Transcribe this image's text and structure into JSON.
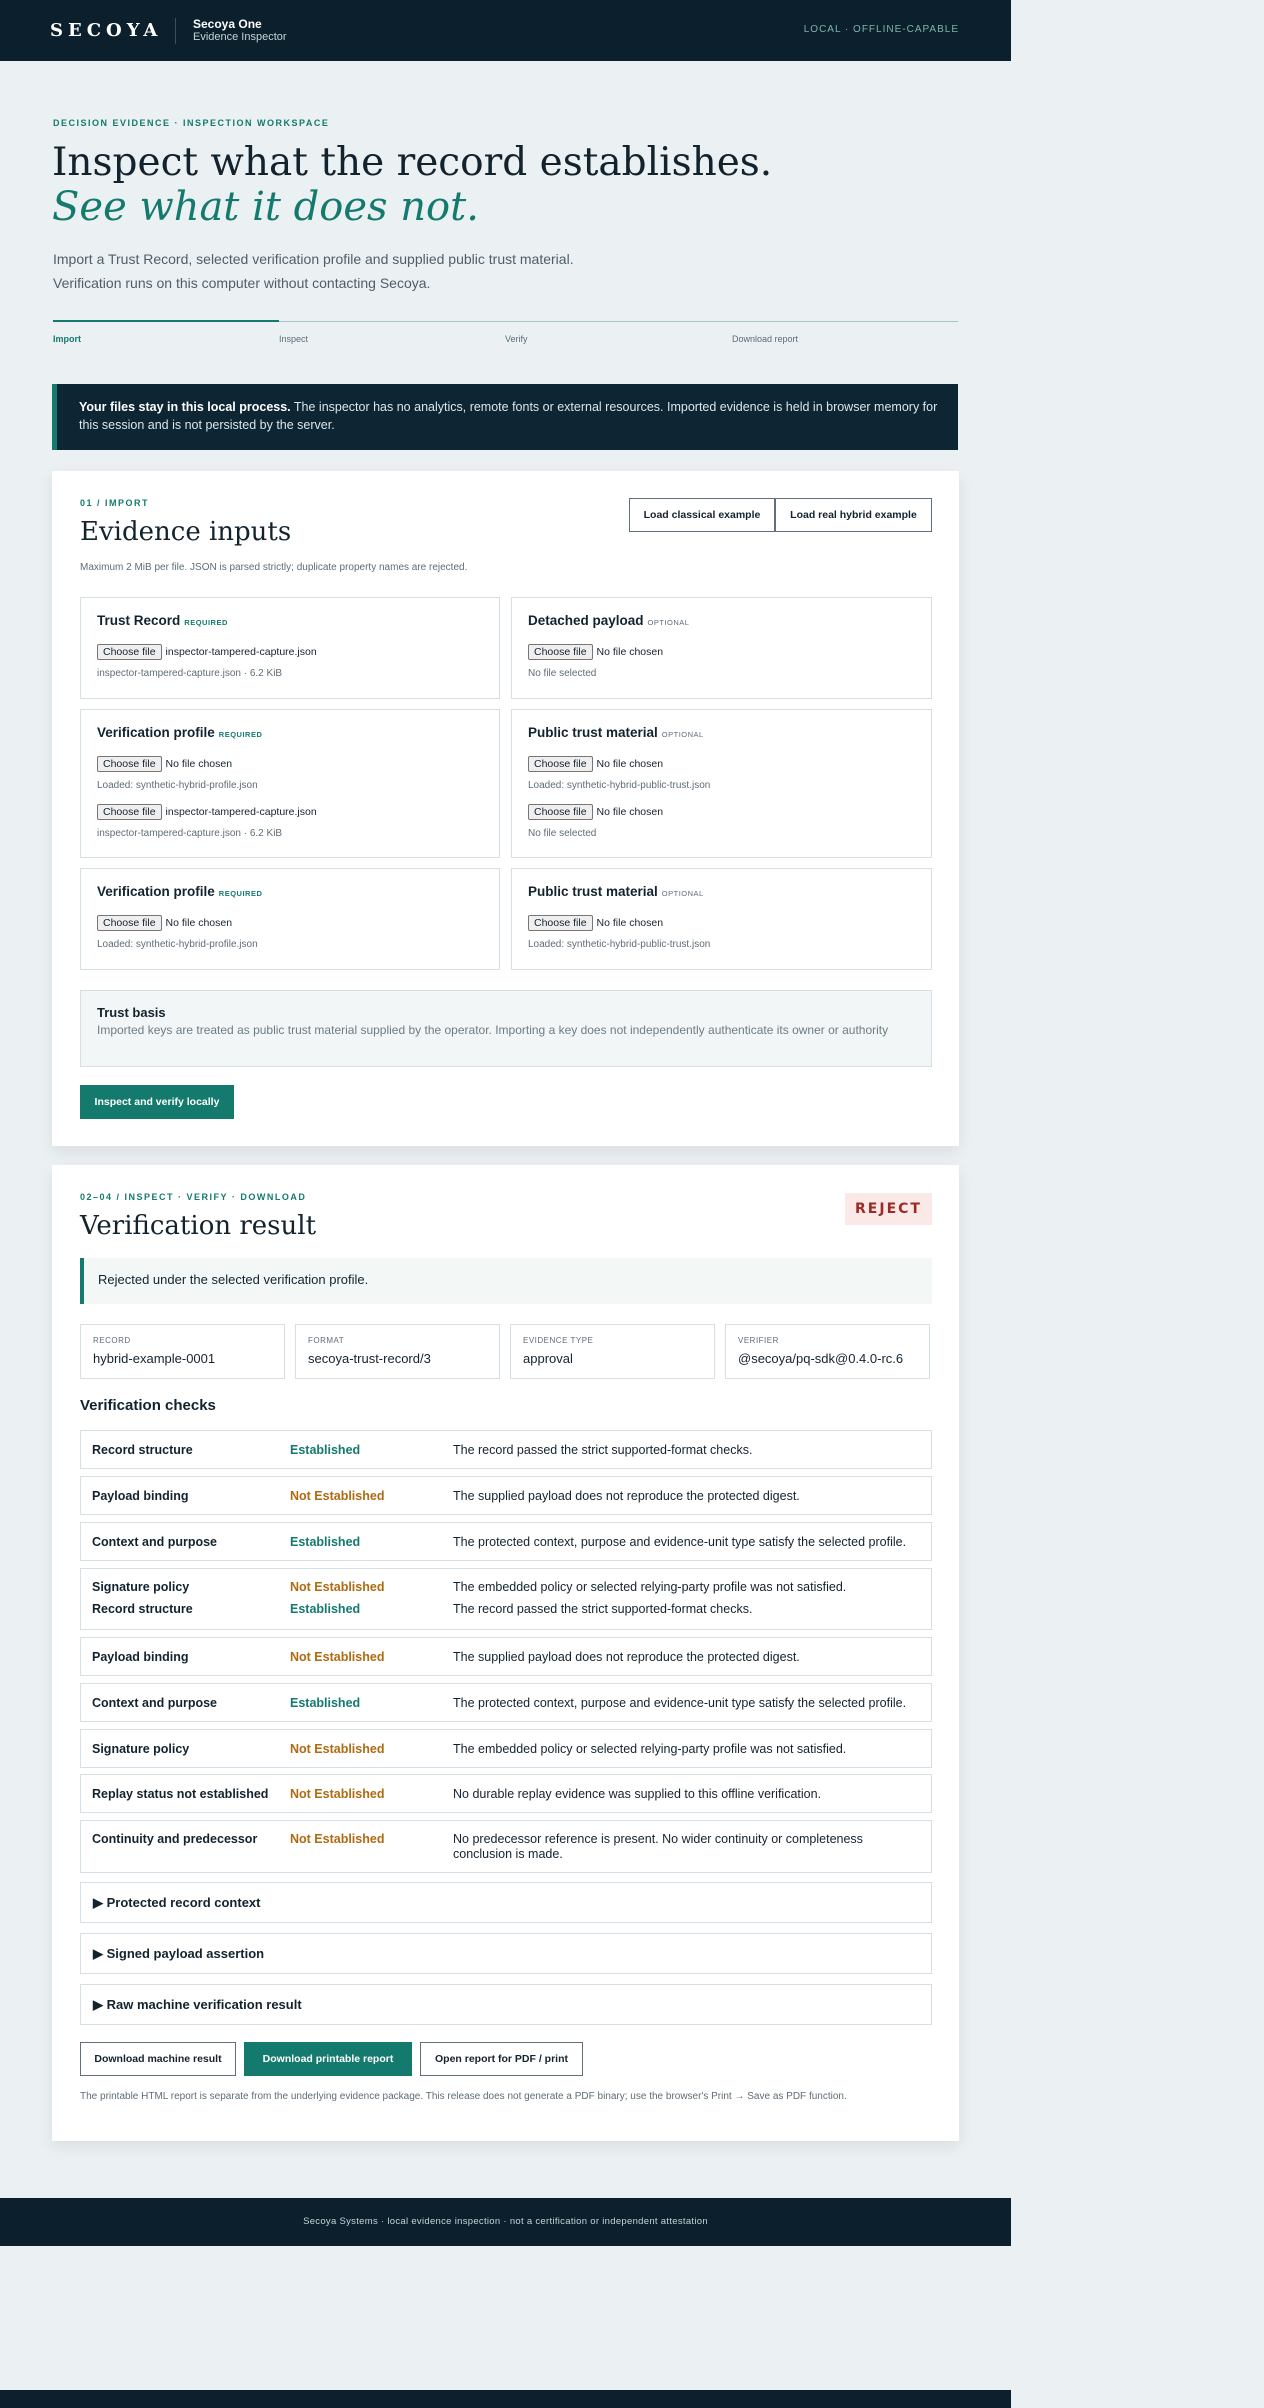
{
  "header": {
    "logo": "SECOYA",
    "product_name": "Secoya One",
    "product_sub": "Evidence Inspector",
    "status": "LOCAL · OFFLINE-CAPABLE"
  },
  "hero": {
    "eyebrow": "DECISION EVIDENCE · INSPECTION WORKSPACE",
    "title": "Inspect what the record establishes.",
    "title_italic": "See what it does not.",
    "lede_1": "Import a Trust Record, selected verification profile and supplied public trust material.",
    "lede_2": "Verification runs on this computer without contacting Secoya."
  },
  "steps": [
    "Import",
    "Inspect",
    "Verify",
    "Download report"
  ],
  "banner": {
    "strong": "Your files stay in this local process.",
    "text": " The inspector has no analytics, remote fonts or external resources. Imported evidence is held in browser memory for this session and is not persisted by the server."
  },
  "import": {
    "kicker": "01 / IMPORT",
    "title": "Evidence inputs",
    "note": "Maximum 2 MiB per file. JSON is parsed strictly; duplicate property names are rejected.",
    "load_classical": "Load classical example",
    "load_hybrid": "Load real hybrid example",
    "choose_label": "Choose file",
    "required": "REQUIRED",
    "optional": "OPTIONAL",
    "cards": {
      "trust_record": {
        "title": "Trust Record",
        "file": "inspector-tampered-capture.json",
        "meta": "inspector-tampered-capture.json · 6.2 KiB"
      },
      "detached_payload": {
        "title": "Detached payload",
        "file": "No file chosen",
        "meta": "No file selected"
      },
      "verification_profile_1": {
        "title": "Verification profile",
        "file": "No file chosen",
        "meta": "Loaded: synthetic-hybrid-profile.json",
        "file2": "inspector-tampered-capture.json",
        "meta2": "inspector-tampered-capture.json · 6.2 KiB"
      },
      "public_trust_1": {
        "title": "Public trust material",
        "file": "No file chosen",
        "meta": "Loaded: synthetic-hybrid-public-trust.json",
        "file2": "No file chosen",
        "meta2": "No file selected"
      },
      "verification_profile_2": {
        "title": "Verification profile",
        "file": "No file chosen",
        "meta": "Loaded: synthetic-hybrid-profile.json"
      },
      "public_trust_2": {
        "title": "Public trust material",
        "file": "No file chosen",
        "meta": "Loaded: synthetic-hybrid-public-trust.json"
      }
    },
    "trust_basis": {
      "title": "Trust basis",
      "text": "Imported keys are treated as public trust material supplied by the operator. Importing a key does not independently authenticate its owner or authority"
    },
    "inspect_button": "Inspect and verify locally"
  },
  "result": {
    "kicker": "02–04 / INSPECT · VERIFY · DOWNLOAD",
    "title": "Verification result",
    "verdict": "REJECT",
    "summary": "Rejected under the selected verification profile.",
    "fields": [
      {
        "label": "RECORD",
        "value": "hybrid-example-0001"
      },
      {
        "label": "FORMAT",
        "value": "secoya-trust-record/3"
      },
      {
        "label": "EVIDENCE TYPE",
        "value": "approval"
      },
      {
        "label": "VERIFIER",
        "value": "@secoya/pq-sdk@0.4.0-rc.6"
      }
    ],
    "checks_title": "Verification checks",
    "checks": [
      {
        "name": "Record structure",
        "status": "Established",
        "desc": "The record passed the strict supported-format checks."
      },
      {
        "name": "Payload binding",
        "status": "Not Established",
        "desc": "The supplied payload does not reproduce the protected digest."
      },
      {
        "name": "Context and purpose",
        "status": "Established",
        "desc": "The protected context, purpose and evidence-unit type satisfy the selected profile."
      },
      {
        "name": "Signature policy",
        "status": "Not Established",
        "desc": "The embedded policy or selected relying-party profile was not satisfied."
      },
      {
        "name": "Record structure",
        "status": "Established",
        "desc": "The record passed the strict supported-format checks."
      },
      {
        "name": "Payload binding",
        "status": "Not Established",
        "desc": "The supplied payload does not reproduce the protected digest."
      },
      {
        "name": "Context and purpose",
        "status": "Established",
        "desc": "The protected context, purpose and evidence-unit type satisfy the selected profile."
      },
      {
        "name": "Signature policy",
        "status": "Not Established",
        "desc": "The embedded policy or selected relying-party profile was not satisfied."
      },
      {
        "name": "Replay status not established",
        "status": "Not Established",
        "desc": "No durable replay evidence was supplied to this offline verification."
      },
      {
        "name": "Continuity and predecessor",
        "status": "Not Established",
        "desc": "No predecessor reference is present. No wider continuity or completeness conclusion is made."
      }
    ],
    "details": [
      "▶ Protected record context",
      "▶ Signed payload assertion",
      "▶ Raw machine verification result"
    ],
    "download_machine": "Download machine result",
    "download_printable": "Download printable report",
    "open_report": "Open report for PDF / print",
    "footnote": "The printable HTML report is separate from the underlying evidence package. This release does not generate a PDF binary; use the browser's Print → Save as PDF function."
  },
  "footer": "Secoya Systems · local evidence inspection · not a certification or independent attestation",
  "colors": {
    "accent": "#147a6d",
    "dark": "#0b202c",
    "warn": "#b06a10",
    "reject": "#9e2a26"
  }
}
